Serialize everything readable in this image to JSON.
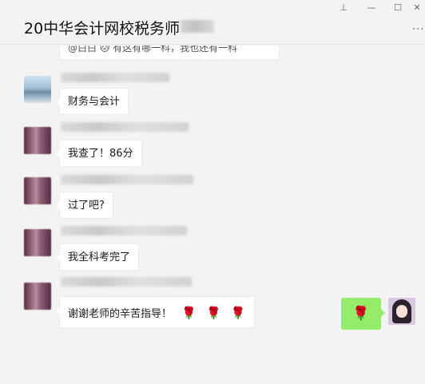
{
  "window": {
    "title": "20中华会计网校税务师",
    "pin_icon": "pin-icon",
    "minimize_icon": "minimize-icon",
    "maximize_icon": "maximize-icon",
    "close_icon": "close-icon",
    "more_icon": "more-icon",
    "pin_glyph": "⊥",
    "minimize_glyph": "—",
    "maximize_glyph": "☐",
    "close_glyph": "✕",
    "more_glyph": "···"
  },
  "messages": [
    {
      "sender_avatar": "avatar-partial",
      "text": "@白白 🐱 有这有哪一科，我也还有一科"
    },
    {
      "sender_avatar": "avatar-lake",
      "text": "财务与会计"
    },
    {
      "sender_avatar": "avatar-purple",
      "text": "我查了！86分"
    },
    {
      "sender_avatar": "avatar-purple",
      "text": "过了吧?"
    },
    {
      "sender_avatar": "avatar-purple",
      "text": "我全科考完了"
    },
    {
      "sender_avatar": "avatar-purple",
      "text": "谢谢老师的辛苦指导！",
      "emoji": [
        "🌹",
        "🌹",
        "🌹"
      ]
    }
  ],
  "my_message": {
    "emoji": "🌹"
  },
  "colors": {
    "background": "#f3f3f3",
    "bubble_incoming": "#ffffff",
    "bubble_outgoing": "#95ec69"
  }
}
